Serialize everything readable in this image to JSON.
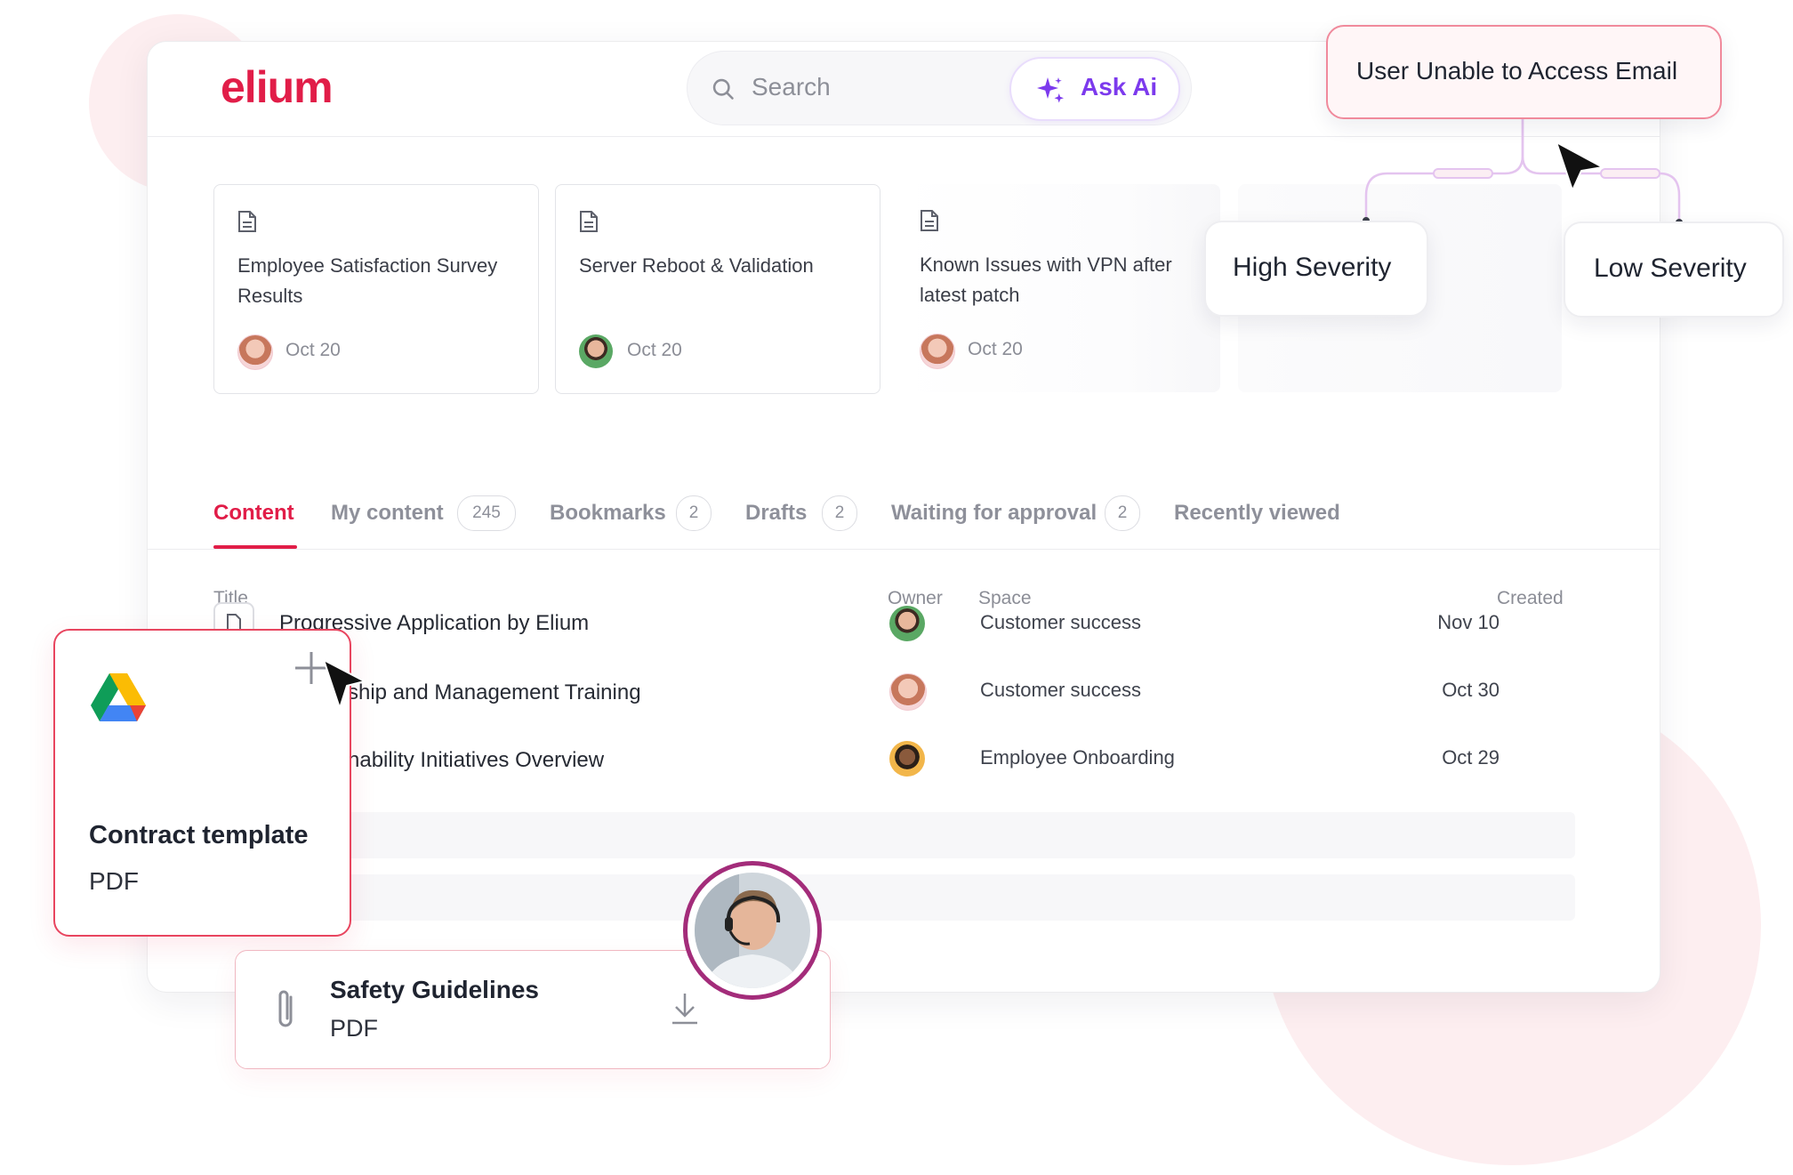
{
  "app": {
    "logo_text": "elium",
    "brand_color": "#e11d48",
    "accent_ai": "#7c3aed"
  },
  "header": {
    "search_placeholder": "Search",
    "ask_ai_label": "Ask Ai"
  },
  "recent_cards": [
    {
      "title": "Employee Satisfaction Survey Results",
      "date": "Oct 20"
    },
    {
      "title": "Server Reboot & Validation",
      "date": "Oct 20"
    },
    {
      "title": "Known Issues with VPN after latest patch",
      "date": "Oct 20"
    }
  ],
  "tabs": [
    {
      "label": "Content"
    },
    {
      "label": "My content",
      "count": "245"
    },
    {
      "label": "Bookmarks",
      "count": "2"
    },
    {
      "label": "Drafts",
      "count": "2"
    },
    {
      "label": "Waiting for approval",
      "count": "2"
    },
    {
      "label": "Recently viewed"
    }
  ],
  "table": {
    "headers": {
      "title": "Title",
      "owner": "Owner",
      "space": "Space",
      "created": "Created"
    },
    "rows": [
      {
        "title": "Progressive Application by Elium",
        "space": "Customer success",
        "created": "Nov 10"
      },
      {
        "title": "ship and Management Training",
        "space": "Customer success",
        "created": "Oct 30"
      },
      {
        "title": "nability Initiatives Overview",
        "space": "Employee Onboarding",
        "created": "Oct 29"
      }
    ]
  },
  "flow": {
    "root": "User Unable to Access Email",
    "left": "High Severity",
    "right": "Low Severity"
  },
  "contract_card": {
    "title": "Contract template",
    "type": "PDF",
    "icon": "google-drive-icon"
  },
  "safety_card": {
    "title": "Safety Guidelines",
    "type": "PDF",
    "icon": "paperclip-icon"
  }
}
